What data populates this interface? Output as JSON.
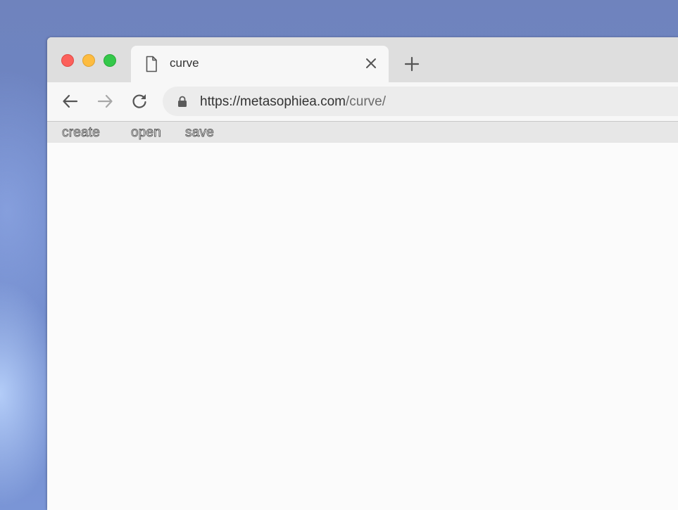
{
  "browser": {
    "tab": {
      "title": "curve",
      "icon": "document-icon"
    },
    "new_tab_icon": "plus-icon",
    "address": {
      "scheme_host": "https://metasophiea.com",
      "path": "/curve/",
      "lock_icon": "lock-icon"
    },
    "colors": {
      "traffic_close": "#fc605b",
      "traffic_minimize": "#fdbc40",
      "traffic_maximize": "#34c84a"
    }
  },
  "app": {
    "menu": {
      "create": "create",
      "open": "open",
      "save": "save"
    }
  }
}
